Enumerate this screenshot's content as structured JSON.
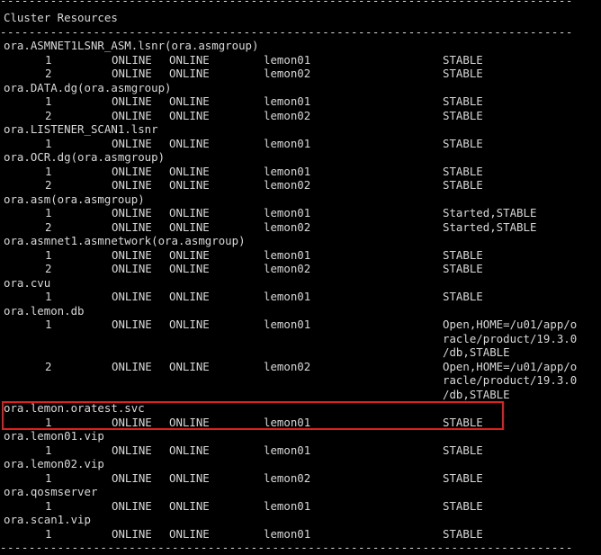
{
  "header": {
    "divider_top": "--------------------------------------------------------------------------------",
    "title": "Cluster Resources",
    "divider_mid": "--------------------------------------------------------------------------------",
    "divider_bottom": "--------------------------------------------------------------------------------"
  },
  "resources": [
    {
      "name": "ora.ASMNET1LSNR_ASM.lsnr(ora.asmgroup)",
      "instances": [
        {
          "num": "1",
          "target": "ONLINE",
          "state": "ONLINE",
          "server": "lemon01",
          "details": [
            "STABLE"
          ]
        },
        {
          "num": "2",
          "target": "ONLINE",
          "state": "ONLINE",
          "server": "lemon02",
          "details": [
            "STABLE"
          ]
        }
      ]
    },
    {
      "name": "ora.DATA.dg(ora.asmgroup)",
      "instances": [
        {
          "num": "1",
          "target": "ONLINE",
          "state": "ONLINE",
          "server": "lemon01",
          "details": [
            "STABLE"
          ]
        },
        {
          "num": "2",
          "target": "ONLINE",
          "state": "ONLINE",
          "server": "lemon02",
          "details": [
            "STABLE"
          ]
        }
      ]
    },
    {
      "name": "ora.LISTENER_SCAN1.lsnr",
      "instances": [
        {
          "num": "1",
          "target": "ONLINE",
          "state": "ONLINE",
          "server": "lemon01",
          "details": [
            "STABLE"
          ]
        }
      ]
    },
    {
      "name": "ora.OCR.dg(ora.asmgroup)",
      "instances": [
        {
          "num": "1",
          "target": "ONLINE",
          "state": "ONLINE",
          "server": "lemon01",
          "details": [
            "STABLE"
          ]
        },
        {
          "num": "2",
          "target": "ONLINE",
          "state": "ONLINE",
          "server": "lemon02",
          "details": [
            "STABLE"
          ]
        }
      ]
    },
    {
      "name": "ora.asm(ora.asmgroup)",
      "instances": [
        {
          "num": "1",
          "target": "ONLINE",
          "state": "ONLINE",
          "server": "lemon01",
          "details": [
            "Started,STABLE"
          ]
        },
        {
          "num": "2",
          "target": "ONLINE",
          "state": "ONLINE",
          "server": "lemon02",
          "details": [
            "Started,STABLE"
          ]
        }
      ]
    },
    {
      "name": "ora.asmnet1.asmnetwork(ora.asmgroup)",
      "instances": [
        {
          "num": "1",
          "target": "ONLINE",
          "state": "ONLINE",
          "server": "lemon01",
          "details": [
            "STABLE"
          ]
        },
        {
          "num": "2",
          "target": "ONLINE",
          "state": "ONLINE",
          "server": "lemon02",
          "details": [
            "STABLE"
          ]
        }
      ]
    },
    {
      "name": "ora.cvu",
      "instances": [
        {
          "num": "1",
          "target": "ONLINE",
          "state": "ONLINE",
          "server": "lemon01",
          "details": [
            "STABLE"
          ]
        }
      ]
    },
    {
      "name": "ora.lemon.db",
      "instances": [
        {
          "num": "1",
          "target": "ONLINE",
          "state": "ONLINE",
          "server": "lemon01",
          "details": [
            "Open,HOME=/u01/app/o",
            "racle/product/19.3.0",
            "/db,STABLE"
          ]
        },
        {
          "num": "2",
          "target": "ONLINE",
          "state": "ONLINE",
          "server": "lemon02",
          "details": [
            "Open,HOME=/u01/app/o",
            "racle/product/19.3.0",
            "/db,STABLE"
          ]
        }
      ]
    },
    {
      "name": "ora.lemon.oratest.svc",
      "highlighted": true,
      "instances": [
        {
          "num": "1",
          "target": "ONLINE",
          "state": "ONLINE",
          "server": "lemon01",
          "details": [
            "STABLE"
          ]
        }
      ]
    },
    {
      "name": "ora.lemon01.vip",
      "instances": [
        {
          "num": "1",
          "target": "ONLINE",
          "state": "ONLINE",
          "server": "lemon01",
          "details": [
            "STABLE"
          ]
        }
      ]
    },
    {
      "name": "ora.lemon02.vip",
      "instances": [
        {
          "num": "1",
          "target": "ONLINE",
          "state": "ONLINE",
          "server": "lemon02",
          "details": [
            "STABLE"
          ]
        }
      ]
    },
    {
      "name": "ora.qosmserver",
      "instances": [
        {
          "num": "1",
          "target": "ONLINE",
          "state": "ONLINE",
          "server": "lemon01",
          "details": [
            "STABLE"
          ]
        }
      ]
    },
    {
      "name": "ora.scan1.vip",
      "instances": [
        {
          "num": "1",
          "target": "ONLINE",
          "state": "ONLINE",
          "server": "lemon01",
          "details": [
            "STABLE"
          ]
        }
      ]
    }
  ],
  "colors": {
    "background": "#000000",
    "text": "#d8d8d8",
    "highlight_border": "#e0201c"
  }
}
